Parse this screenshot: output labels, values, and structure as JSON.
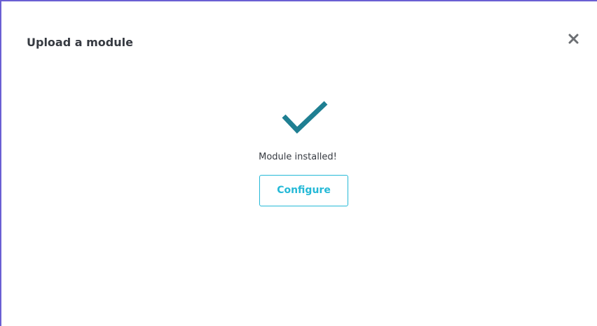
{
  "modal": {
    "title": "Upload a module",
    "close_icon": "close-icon"
  },
  "result": {
    "icon": "checkmark-icon",
    "icon_color": "#1f7f92",
    "message": "Module installed!",
    "configure_label": "Configure",
    "accent_color": "#25b9d7"
  }
}
